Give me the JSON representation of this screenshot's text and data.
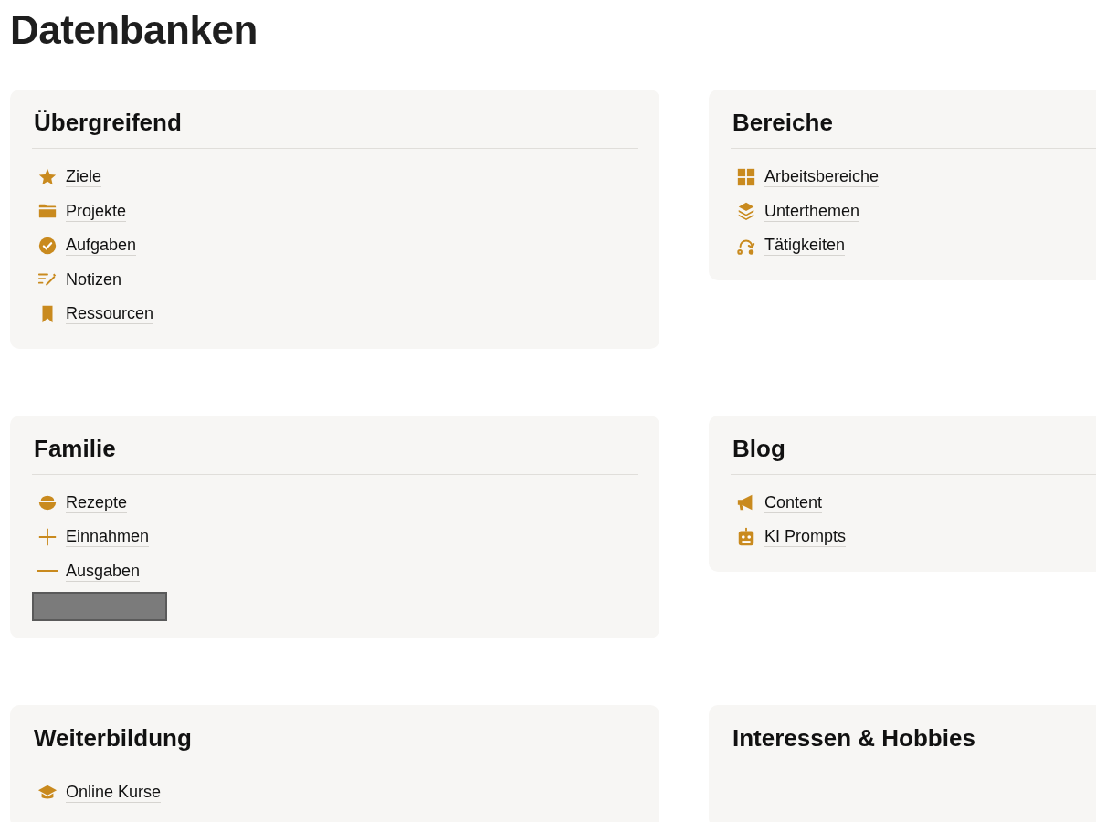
{
  "page_title": "Datenbanken",
  "sections": [
    {
      "title": "Übergreifend",
      "items": [
        {
          "kind": "star",
          "label": "Ziele"
        },
        {
          "kind": "folder",
          "label": "Projekte"
        },
        {
          "kind": "check",
          "label": "Aufgaben"
        },
        {
          "kind": "notes",
          "label": "Notizen"
        },
        {
          "kind": "bookmark",
          "label": "Ressourcen"
        }
      ]
    },
    {
      "title": "Bereiche",
      "items": [
        {
          "kind": "grid",
          "label": "Arbeitsbereiche"
        },
        {
          "kind": "layers",
          "label": "Unterthemen"
        },
        {
          "kind": "route",
          "label": "Tätigkeiten"
        }
      ]
    },
    {
      "title": "Familie",
      "items": [
        {
          "kind": "bowl",
          "label": "Rezepte"
        },
        {
          "kind": "plus",
          "label": "Einnahmen"
        },
        {
          "kind": "minus",
          "label": "Ausgaben"
        },
        {
          "kind": "redacted"
        }
      ]
    },
    {
      "title": "Blog",
      "items": [
        {
          "kind": "megaphone",
          "label": "Content"
        },
        {
          "kind": "robot",
          "label": "KI Prompts"
        }
      ]
    },
    {
      "title": "Weiterbildung",
      "items": [
        {
          "kind": "cap",
          "label": "Online Kurse"
        }
      ]
    },
    {
      "title": "Interessen & Hobbies"
    }
  ]
}
